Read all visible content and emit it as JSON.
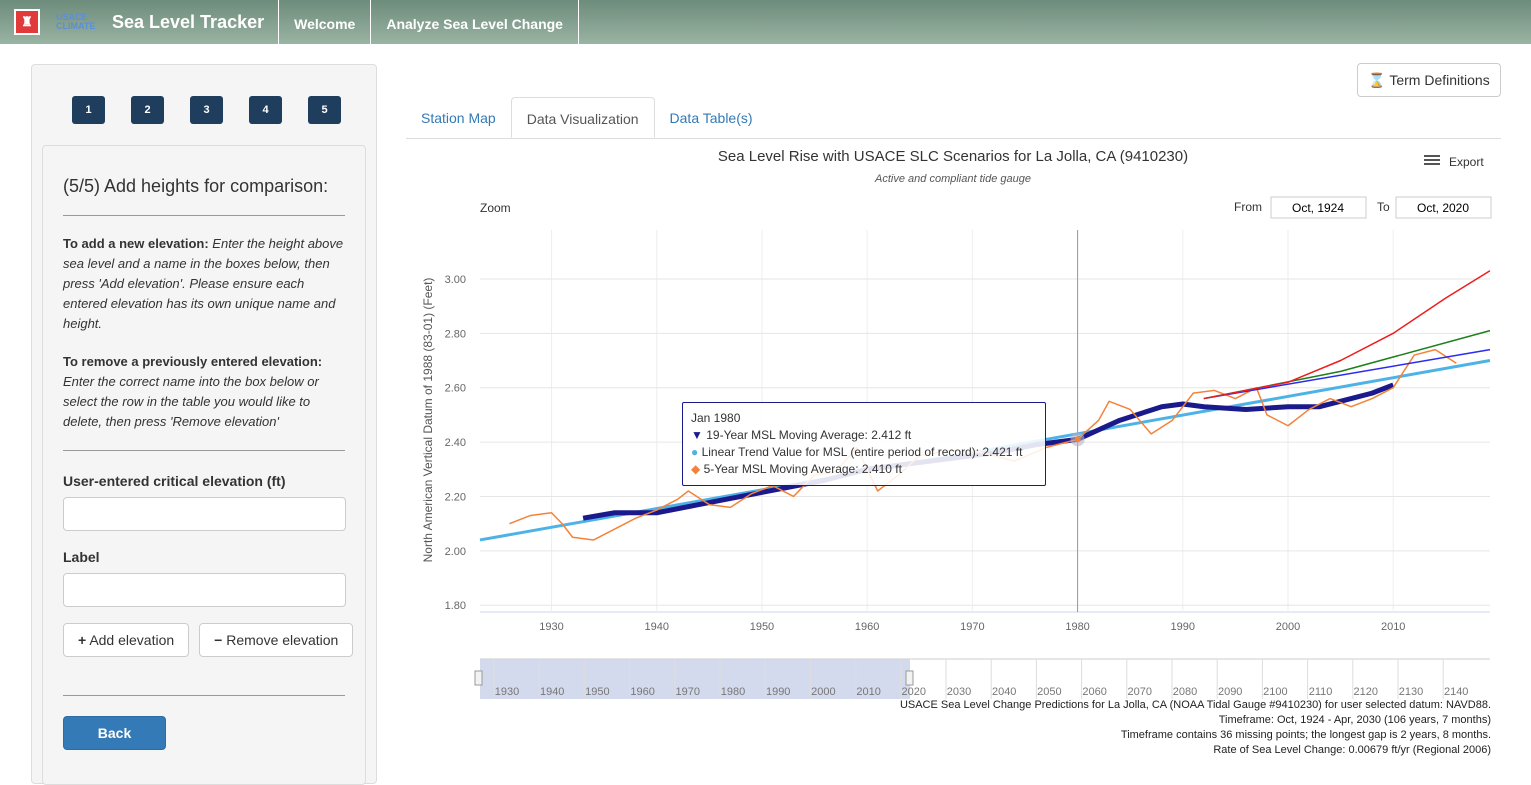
{
  "header": {
    "logo_text": "USACE CLIMATE PREPAREDNESS AND RESILIENCE",
    "title": "Sea Level Tracker",
    "nav": [
      "Welcome",
      "Analyze Sea Level Change"
    ]
  },
  "sidebar": {
    "steps": [
      "1",
      "2",
      "3",
      "4",
      "5"
    ],
    "heading": "(5/5) Add heights for comparison:",
    "add_bold": "To add a new elevation:",
    "add_text": " Enter the height above sea level and a name in the boxes below, then press 'Add elevation'. Please ensure each entered elevation has its own unique name and height.",
    "remove_bold": "To remove a previously entered elevation:",
    "remove_text": "Enter the correct name into the box below or select the row in the table you would like to delete, then press 'Remove elevation'",
    "elev_label": "User-entered critical elevation (ft)",
    "elev_value": "",
    "label_label": "Label",
    "label_value": "",
    "add_btn": "Add elevation",
    "remove_btn": "Remove elevation",
    "back_btn": "Back"
  },
  "term_btn": "Term Definitions",
  "tabs": [
    "Station Map",
    "Data Visualization",
    "Data Table(s)"
  ],
  "chart_controls": {
    "zoom": "Zoom",
    "from_label": "From",
    "from": "Oct, 1924",
    "to_label": "To",
    "to": "Oct, 2020",
    "export": "Export"
  },
  "tooltip": {
    "title": "Jan 1980",
    "rows": [
      "19-Year MSL Moving Average: 2.412 ft",
      "Linear Trend Value for MSL (entire period of record): 2.421 ft",
      "5-Year MSL Moving Average: 2.410 ft"
    ]
  },
  "navigator_ticks": [
    "1930",
    "1940",
    "1950",
    "1960",
    "1970",
    "1980",
    "1990",
    "2000",
    "2010",
    "2020",
    "2030",
    "2040",
    "2050",
    "2060",
    "2070",
    "2080",
    "2090",
    "2100",
    "2110",
    "2120",
    "2130",
    "2140"
  ],
  "footer": [
    "USACE Sea Level Change Predictions for La Jolla, CA (NOAA Tidal Gauge #9410230) for user selected datum: NAVD88.",
    "Timeframe: Oct, 1924 - Apr, 2030 (106 years, 7 months)",
    "Timeframe contains 36 missing points; the longest gap is 2 years, 8 months.",
    "Rate of Sea Level Change: 0.00679 ft/yr (Regional 2006)"
  ],
  "chart_data": {
    "type": "line",
    "title": "Sea Level Rise with USACE SLC Scenarios for La Jolla, CA (9410230)",
    "subtitle": "Active and compliant tide gauge",
    "xlabel": "",
    "ylabel": "North American Vertical Datum of 1988 (83-01) (Feet)",
    "xlim": [
      1923.2,
      2019.2
    ],
    "ylim": [
      1.775,
      3.18
    ],
    "xticks": [
      1930,
      1940,
      1950,
      1960,
      1970,
      1980,
      1990,
      2000,
      2010
    ],
    "yticks": [
      "1.80",
      "2.00",
      "2.20",
      "2.40",
      "2.60",
      "2.80",
      "3.00"
    ],
    "grid": true,
    "crosshair_x": 1980,
    "series": [
      {
        "key": "linear",
        "color": "#4db3e6",
        "width": 3,
        "points": [
          [
            1923.2,
            2.04
          ],
          [
            2019.2,
            2.7
          ]
        ]
      },
      {
        "key": "ma19",
        "color": "#1a1a8c",
        "width": 5,
        "points": [
          [
            1933,
            2.12
          ],
          [
            1936,
            2.14
          ],
          [
            1940,
            2.14
          ],
          [
            1944,
            2.17
          ],
          [
            1948,
            2.2
          ],
          [
            1952,
            2.23
          ],
          [
            1956,
            2.26
          ],
          [
            1960,
            2.3
          ],
          [
            1964,
            2.32
          ],
          [
            1968,
            2.34
          ],
          [
            1972,
            2.36
          ],
          [
            1976,
            2.39
          ],
          [
            1980,
            2.41
          ],
          [
            1984,
            2.48
          ],
          [
            1988,
            2.53
          ],
          [
            1990,
            2.54
          ],
          [
            1992,
            2.53
          ],
          [
            1996,
            2.52
          ],
          [
            2000,
            2.53
          ],
          [
            2003,
            2.53
          ],
          [
            2006,
            2.56
          ],
          [
            2008,
            2.58
          ],
          [
            2010,
            2.61
          ]
        ]
      },
      {
        "key": "ma5",
        "color": "#f5823a",
        "width": 1.5,
        "points": [
          [
            1926,
            2.1
          ],
          [
            1928,
            2.13
          ],
          [
            1930,
            2.14
          ],
          [
            1931,
            2.1
          ],
          [
            1932,
            2.05
          ],
          [
            1934,
            2.04
          ],
          [
            1936,
            2.08
          ],
          [
            1938,
            2.12
          ],
          [
            1940,
            2.15
          ],
          [
            1942,
            2.19
          ],
          [
            1943,
            2.22
          ],
          [
            1945,
            2.17
          ],
          [
            1947,
            2.16
          ],
          [
            1949,
            2.21
          ],
          [
            1951,
            2.24
          ],
          [
            1953,
            2.2
          ],
          [
            1955,
            2.28
          ],
          [
            1957,
            2.29
          ],
          [
            1959,
            2.38
          ],
          [
            1961,
            2.22
          ],
          [
            1963,
            2.28
          ],
          [
            1965,
            2.35
          ],
          [
            1968,
            2.37
          ],
          [
            1971,
            2.36
          ],
          [
            1974,
            2.33
          ],
          [
            1977,
            2.38
          ],
          [
            1980,
            2.41
          ],
          [
            1982,
            2.48
          ],
          [
            1983,
            2.55
          ],
          [
            1985,
            2.52
          ],
          [
            1987,
            2.43
          ],
          [
            1989,
            2.48
          ],
          [
            1991,
            2.58
          ],
          [
            1993,
            2.59
          ],
          [
            1995,
            2.56
          ],
          [
            1997,
            2.6
          ],
          [
            1998,
            2.5
          ],
          [
            2000,
            2.46
          ],
          [
            2002,
            2.52
          ],
          [
            2004,
            2.56
          ],
          [
            2006,
            2.53
          ],
          [
            2008,
            2.56
          ],
          [
            2010,
            2.6
          ],
          [
            2012,
            2.72
          ],
          [
            2014,
            2.74
          ],
          [
            2016,
            2.69
          ]
        ]
      },
      {
        "key": "low",
        "color": "#2b2bf0",
        "width": 1.5,
        "points": [
          [
            1992,
            2.56
          ],
          [
            2019.2,
            2.74
          ]
        ]
      },
      {
        "key": "intermediate",
        "color": "#1a801a",
        "width": 1.5,
        "points": [
          [
            1992,
            2.56
          ],
          [
            2005,
            2.66
          ],
          [
            2019.2,
            2.81
          ]
        ]
      },
      {
        "key": "high",
        "color": "#ee1c1c",
        "width": 1.5,
        "points": [
          [
            1992,
            2.56
          ],
          [
            2000,
            2.62
          ],
          [
            2005,
            2.7
          ],
          [
            2010,
            2.8
          ],
          [
            2015,
            2.93
          ],
          [
            2019.2,
            3.03
          ]
        ]
      }
    ]
  }
}
